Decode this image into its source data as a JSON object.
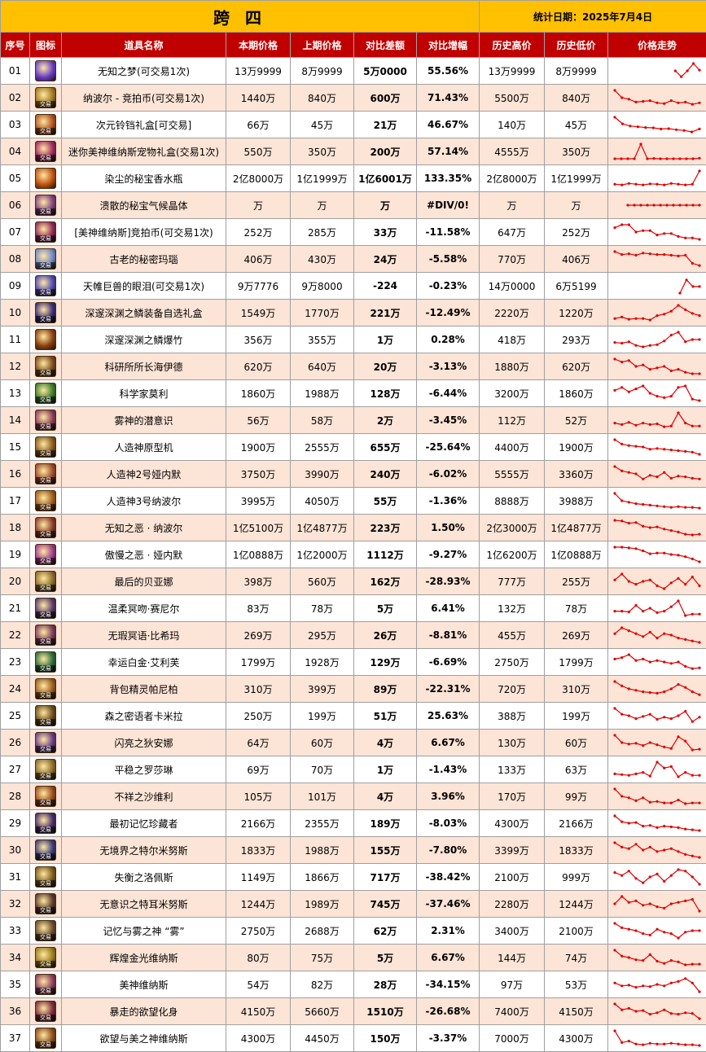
{
  "header": {
    "title": "跨 四",
    "date": "统计日期：2025年7月4日"
  },
  "columns": [
    "序号",
    "图标",
    "道具名称",
    "本期价格",
    "上期价格",
    "对比差额",
    "对比增幅",
    "历史高价",
    "历史低价",
    "价格走势"
  ],
  "icon_tag": "交易",
  "colors": {
    "header_bg": "#c00000",
    "title_bg": "#ffc000",
    "alt_row": "#fce4d6",
    "up": "#e00000",
    "down": "#00a040",
    "spark": "#e00000"
  },
  "rows": [
    {
      "no": "01",
      "name": "无知之梦(可交易1次)",
      "cur": "13万9999",
      "prev": "8万9999",
      "diff": "5万0000",
      "pct": "55.56%",
      "high": "13万9999",
      "low": "8万9999",
      "dir": "up",
      "icon": "purple-orb-icon",
      "icon_color": "#6a3cc8",
      "tag": false,
      "trend": [
        null,
        null,
        null,
        null,
        null,
        null,
        null,
        null,
        null,
        null,
        0.5,
        0.1,
        0.5,
        1.0,
        0.55
      ]
    },
    {
      "no": "02",
      "name": "纳波尔 - 竞拍币(可交易1次)",
      "cur": "1440万",
      "prev": "840万",
      "diff": "600万",
      "pct": "71.43%",
      "high": "5500万",
      "low": "840万",
      "dir": "up",
      "icon": "gold-coin-icon",
      "icon_color": "#a07820",
      "tag": true,
      "trend": [
        1.0,
        0.5,
        0.4,
        0.2,
        0.25,
        0.3,
        0.15,
        0.1,
        0.3,
        0.15,
        0.2,
        0.05,
        0.15
      ]
    },
    {
      "no": "03",
      "name": "次元铃铛礼盒[可交易]",
      "cur": "66万",
      "prev": "45万",
      "diff": "21万",
      "pct": "46.67%",
      "high": "140万",
      "low": "45万",
      "dir": "up",
      "icon": "bell-box-icon",
      "icon_color": "#b05020",
      "tag": true,
      "trend": [
        1.0,
        0.55,
        0.4,
        0.35,
        0.3,
        0.28,
        0.2,
        0.22,
        0.15,
        0.1,
        0.0,
        0.2
      ]
    },
    {
      "no": "04",
      "name": "迷你美神维纳斯宠物礼盒(交易1次)",
      "cur": "550万",
      "prev": "350万",
      "diff": "200万",
      "pct": "57.14%",
      "high": "4555万",
      "low": "350万",
      "dir": "up",
      "icon": "pet-box-icon",
      "icon_color": "#a02860",
      "tag": true,
      "trend": [
        0.0,
        0.0,
        0.0,
        0.0,
        1.0,
        0.0,
        0.02,
        0.0,
        0.0,
        0.0,
        0.0,
        0.0,
        0.0,
        0.04
      ]
    },
    {
      "no": "05",
      "name": "染尘的秘宝香水瓶",
      "cur": "2亿8000万",
      "prev": "1亿1999万",
      "diff": "1亿6001万",
      "pct": "133.35%",
      "high": "2亿8000万",
      "low": "1亿1999万",
      "dir": "up",
      "icon": "perfume-icon",
      "icon_color": "#c05010",
      "tag": false,
      "trend": [
        0.1,
        0.05,
        0.15,
        0.1,
        0.05,
        0.12,
        0.1,
        0.05,
        0.15,
        0.1,
        0.05,
        0.1,
        1.0
      ]
    },
    {
      "no": "06",
      "name": "溃散的秘宝气候晶体",
      "cur": "万",
      "prev": "万",
      "diff": "万",
      "pct": "#DIV/0!",
      "high": "万",
      "low": "万",
      "dir": "up",
      "icon": "crystal-icon",
      "icon_color": "#804080",
      "tag": true,
      "trend": [
        null,
        null,
        0.5,
        0.5,
        0.5,
        0.5,
        0.5,
        0.5,
        0.5,
        0.5,
        0.5,
        0.5,
        0.5,
        0.5
      ]
    },
    {
      "no": "07",
      "name": "[美神维纳斯]竞拍币(可交易1次)",
      "cur": "252万",
      "prev": "285万",
      "diff": "33万",
      "pct": "-11.58%",
      "high": "647万",
      "low": "252万",
      "dir": "down",
      "icon": "auction-coin-icon",
      "icon_color": "#902858",
      "tag": true,
      "trend": [
        0.8,
        1.0,
        1.0,
        0.5,
        0.6,
        0.6,
        0.3,
        0.4,
        0.4,
        0.2,
        0.1,
        0.1,
        0.0
      ]
    },
    {
      "no": "08",
      "name": "古老的秘密玛瑙",
      "cur": "406万",
      "prev": "430万",
      "diff": "24万",
      "pct": "-5.58%",
      "high": "770万",
      "low": "406万",
      "dir": "down",
      "icon": "agate-icon",
      "icon_color": "#7088c8",
      "tag": true,
      "trend": [
        1.0,
        0.8,
        0.85,
        0.75,
        0.9,
        0.85,
        0.8,
        0.8,
        0.75,
        0.7,
        0.75,
        0.2,
        0.05
      ]
    },
    {
      "no": "09",
      "name": "天帷巨兽的眼泪(可交易1次)",
      "cur": "9万7776",
      "prev": "9万8000",
      "diff": "-224",
      "pct": "-0.23%",
      "high": "14万0000",
      "low": "6万5199",
      "dir": "down",
      "icon": "tear-icon",
      "icon_color": "#5048b0",
      "tag": true,
      "trend": [
        null,
        null,
        null,
        null,
        null,
        null,
        null,
        null,
        null,
        null,
        0.0,
        0.9,
        0.45,
        0.45
      ]
    },
    {
      "no": "10",
      "name": "深邃深渊之鳞装备自选礼盒",
      "cur": "1549万",
      "prev": "1770万",
      "diff": "221万",
      "pct": "-12.49%",
      "high": "2220万",
      "low": "1220万",
      "dir": "down",
      "icon": "scale-box-icon",
      "icon_color": "#3a2a78",
      "tag": true,
      "trend": [
        0.1,
        0.2,
        0.05,
        0.1,
        0.1,
        0.0,
        0.3,
        0.4,
        0.6,
        1.0,
        0.7,
        0.45,
        0.3
      ]
    },
    {
      "no": "11",
      "name": "深邃深渊之鳞爆竹",
      "cur": "356万",
      "prev": "355万",
      "diff": "1万",
      "pct": "0.28%",
      "high": "418万",
      "low": "293万",
      "dir": "up",
      "icon": "firecracker-icon",
      "icon_color": "#8a4010",
      "tag": false,
      "trend": [
        0.3,
        0.25,
        0.35,
        0.1,
        0.0,
        0.1,
        0.15,
        0.4,
        0.8,
        1.0,
        0.35,
        0.5,
        0.5
      ]
    },
    {
      "no": "12",
      "name": "科研所所长海伊德",
      "cur": "620万",
      "prev": "640万",
      "diff": "20万",
      "pct": "-3.13%",
      "high": "1880万",
      "low": "620万",
      "dir": "down",
      "icon": "card-icon",
      "icon_color": "#7a4a1a",
      "tag": true,
      "trend": [
        1.0,
        0.8,
        0.9,
        0.5,
        0.6,
        0.3,
        0.4,
        0.5,
        0.2,
        0.3,
        0.1,
        0.0,
        0.0
      ]
    },
    {
      "no": "13",
      "name": "科学家莫利",
      "cur": "1860万",
      "prev": "1988万",
      "diff": "128万",
      "pct": "-6.44%",
      "high": "3200万",
      "low": "1860万",
      "dir": "down",
      "icon": "card-icon",
      "icon_color": "#3a7a2a",
      "tag": true,
      "trend": [
        0.7,
        0.9,
        0.6,
        0.8,
        1.0,
        0.5,
        0.3,
        0.2,
        0.3,
        0.9,
        1.0,
        0.1,
        0.0
      ]
    },
    {
      "no": "14",
      "name": "雾神的潜意识",
      "cur": "56万",
      "prev": "58万",
      "diff": "2万",
      "pct": "-3.45%",
      "high": "112万",
      "low": "52万",
      "dir": "down",
      "icon": "card-icon",
      "icon_color": "#8a3a5a",
      "tag": true,
      "trend": [
        0.3,
        0.2,
        0.35,
        0.15,
        0.3,
        0.2,
        0.25,
        0.05,
        0.1,
        1.0,
        0.3,
        0.1,
        0.1
      ]
    },
    {
      "no": "15",
      "name": "人造神原型机",
      "cur": "1900万",
      "prev": "2555万",
      "diff": "655万",
      "pct": "-25.64%",
      "high": "4400万",
      "low": "1900万",
      "dir": "down",
      "icon": "card-icon",
      "icon_color": "#8a5a1a",
      "tag": true,
      "trend": [
        1.0,
        0.7,
        0.6,
        0.55,
        0.5,
        0.35,
        0.4,
        0.35,
        0.3,
        0.25,
        0.2,
        0.15,
        0.0
      ]
    },
    {
      "no": "16",
      "name": "人造神2号娅内默",
      "cur": "3750万",
      "prev": "3990万",
      "diff": "240万",
      "pct": "-6.02%",
      "high": "5555万",
      "low": "3360万",
      "dir": "down",
      "icon": "card-icon",
      "icon_color": "#9a4a2a",
      "tag": true,
      "trend": [
        1.0,
        0.7,
        0.6,
        0.5,
        0.15,
        0.4,
        0.3,
        0.6,
        0.2,
        0.35,
        0.3,
        0.2,
        0.15
      ]
    },
    {
      "no": "17",
      "name": "人造神3号纳波尔",
      "cur": "3995万",
      "prev": "4050万",
      "diff": "55万",
      "pct": "-1.36%",
      "high": "8888万",
      "low": "3988万",
      "dir": "down",
      "icon": "card-icon",
      "icon_color": "#a05a1a",
      "tag": true,
      "trend": [
        1.0,
        0.5,
        0.4,
        0.3,
        0.25,
        0.2,
        0.15,
        0.1,
        0.05,
        0.1,
        0.05,
        0.05,
        0.0
      ]
    },
    {
      "no": "18",
      "name": "无知之恶 · 纳波尔",
      "cur": "1亿5100万",
      "prev": "1亿4877万",
      "diff": "223万",
      "pct": "1.50%",
      "high": "2亿3000万",
      "low": "1亿4877万",
      "dir": "up",
      "icon": "card-icon",
      "icon_color": "#8a3a2a",
      "tag": true,
      "trend": [
        1.0,
        0.95,
        0.8,
        0.85,
        0.6,
        0.5,
        0.55,
        0.4,
        0.3,
        0.2,
        0.05,
        0.0,
        0.05
      ]
    },
    {
      "no": "19",
      "name": "傲慢之恶 · 娅内默",
      "cur": "1亿0888万",
      "prev": "1亿2000万",
      "diff": "1112万",
      "pct": "-9.27%",
      "high": "1亿6200万",
      "low": "1亿0888万",
      "dir": "down",
      "icon": "card-icon",
      "icon_color": "#a03a8a",
      "tag": true,
      "trend": [
        1.0,
        1.0,
        0.95,
        0.9,
        0.75,
        0.55,
        0.6,
        0.6,
        0.5,
        0.45,
        0.35,
        0.2,
        0.0
      ]
    },
    {
      "no": "20",
      "name": "最后的贝亚娜",
      "cur": "398万",
      "prev": "560万",
      "diff": "162万",
      "pct": "-28.93%",
      "high": "777万",
      "low": "255万",
      "dir": "down",
      "icon": "card-icon",
      "icon_color": "#8a6a2a",
      "tag": true,
      "trend": [
        0.6,
        1.0,
        0.5,
        0.3,
        0.5,
        0.6,
        0.2,
        0.0,
        0.4,
        0.7,
        0.3,
        0.8,
        0.2
      ]
    },
    {
      "no": "21",
      "name": "温柔冥吻·赛尼尔",
      "cur": "83万",
      "prev": "78万",
      "diff": "5万",
      "pct": "6.41%",
      "high": "132万",
      "low": "78万",
      "dir": "up",
      "icon": "card-icon",
      "icon_color": "#5a3a6a",
      "tag": true,
      "trend": [
        0.3,
        0.3,
        0.25,
        0.7,
        0.3,
        0.5,
        0.2,
        0.3,
        0.6,
        1.0,
        0.0,
        0.1,
        0.1
      ]
    },
    {
      "no": "22",
      "name": "无瑕冥语·比希玛",
      "cur": "269万",
      "prev": "295万",
      "diff": "26万",
      "pct": "-8.81%",
      "high": "455万",
      "low": "269万",
      "dir": "down",
      "icon": "card-icon",
      "icon_color": "#7a3a5a",
      "tag": true,
      "trend": [
        0.6,
        1.0,
        0.8,
        0.6,
        0.4,
        0.7,
        0.3,
        0.6,
        0.5,
        0.3,
        0.2,
        0.1,
        0.0
      ]
    },
    {
      "no": "23",
      "name": "幸运白金·艾利芙",
      "cur": "1799万",
      "prev": "1928万",
      "diff": "129万",
      "pct": "-6.69%",
      "high": "2750万",
      "low": "1799万",
      "dir": "down",
      "icon": "card-icon",
      "icon_color": "#2a6a3a",
      "tag": true,
      "trend": [
        0.7,
        0.8,
        1.0,
        0.6,
        0.7,
        0.5,
        0.6,
        0.5,
        0.4,
        0.5,
        0.2,
        0.05,
        0.1
      ]
    },
    {
      "no": "24",
      "name": "背包精灵帕尼柏",
      "cur": "310万",
      "prev": "399万",
      "diff": "89万",
      "pct": "-22.31%",
      "high": "720万",
      "low": "310万",
      "dir": "down",
      "icon": "card-icon",
      "icon_color": "#9a5a1a",
      "tag": true,
      "trend": [
        1.0,
        0.7,
        0.5,
        0.4,
        0.3,
        0.25,
        0.2,
        0.3,
        0.5,
        0.8,
        0.6,
        0.3,
        0.1
      ]
    },
    {
      "no": "25",
      "name": "森之密语者卡米拉",
      "cur": "250万",
      "prev": "199万",
      "diff": "51万",
      "pct": "25.63%",
      "high": "388万",
      "low": "199万",
      "dir": "up",
      "icon": "card-icon",
      "icon_color": "#6a4a1a",
      "tag": true,
      "trend": [
        1.0,
        0.6,
        0.5,
        0.3,
        0.45,
        0.6,
        0.25,
        0.4,
        0.3,
        0.5,
        0.8,
        0.1,
        0.4
      ]
    },
    {
      "no": "26",
      "name": "闪亮之狄安娜",
      "cur": "64万",
      "prev": "60万",
      "diff": "4万",
      "pct": "6.67%",
      "high": "130万",
      "low": "60万",
      "dir": "up",
      "icon": "card-icon",
      "icon_color": "#6a3a8a",
      "tag": true,
      "trend": [
        1.0,
        0.5,
        0.4,
        0.45,
        0.3,
        0.5,
        0.35,
        0.2,
        0.1,
        0.9,
        0.6,
        0.0,
        0.05
      ]
    },
    {
      "no": "27",
      "name": "平稳之罗莎琳",
      "cur": "69万",
      "prev": "70万",
      "diff": "1万",
      "pct": "-1.43%",
      "high": "133万",
      "low": "63万",
      "dir": "down",
      "icon": "card-icon",
      "icon_color": "#8a6a2a",
      "tag": true,
      "trend": [
        0.2,
        0.15,
        0.1,
        0.2,
        0.3,
        0.05,
        1.0,
        0.6,
        0.7,
        0.0,
        0.3,
        0.1,
        0.1
      ]
    },
    {
      "no": "28",
      "name": "不祥之沙维利",
      "cur": "105万",
      "prev": "101万",
      "diff": "4万",
      "pct": "3.96%",
      "high": "170万",
      "low": "99万",
      "dir": "up",
      "icon": "card-icon",
      "icon_color": "#9a4a1a",
      "tag": true,
      "trend": [
        1.0,
        0.5,
        0.4,
        0.2,
        0.4,
        0.1,
        0.15,
        0.05,
        0.05,
        0.25,
        0.0,
        0.05,
        0.05
      ]
    },
    {
      "no": "29",
      "name": "最初记忆珍藏者",
      "cur": "2166万",
      "prev": "2355万",
      "diff": "189万",
      "pct": "-8.03%",
      "high": "4300万",
      "low": "2166万",
      "dir": "down",
      "icon": "card-icon",
      "icon_color": "#4a2a6a",
      "tag": true,
      "trend": [
        1.0,
        0.6,
        0.5,
        0.55,
        0.3,
        0.35,
        0.2,
        0.3,
        0.25,
        0.2,
        0.1,
        0.05,
        0.0
      ]
    },
    {
      "no": "30",
      "name": "无境界之特尔米努斯",
      "cur": "1833万",
      "prev": "1988万",
      "diff": "155万",
      "pct": "-7.80%",
      "high": "3399万",
      "low": "1833万",
      "dir": "down",
      "icon": "card-icon",
      "icon_color": "#3a3a7a",
      "tag": true,
      "trend": [
        1.0,
        0.7,
        0.6,
        0.9,
        0.5,
        0.7,
        0.4,
        0.5,
        0.6,
        0.4,
        0.2,
        0.1,
        0.0
      ]
    },
    {
      "no": "31",
      "name": "失衡之洛佩斯",
      "cur": "1149万",
      "prev": "1866万",
      "diff": "717万",
      "pct": "-38.42%",
      "high": "2100万",
      "low": "999万",
      "dir": "down",
      "icon": "card-icon",
      "icon_color": "#7a5a1a",
      "tag": true,
      "trend": [
        0.8,
        0.6,
        0.9,
        0.4,
        0.1,
        0.5,
        0.7,
        0.2,
        0.6,
        1.0,
        0.9,
        0.5,
        0.0
      ]
    },
    {
      "no": "32",
      "name": "无意识之特耳米努斯",
      "cur": "1244万",
      "prev": "1989万",
      "diff": "745万",
      "pct": "-37.46%",
      "high": "2280万",
      "low": "1244万",
      "dir": "down",
      "icon": "card-icon",
      "icon_color": "#5a3a2a",
      "tag": true,
      "trend": [
        0.5,
        1.0,
        0.6,
        0.7,
        0.4,
        0.5,
        0.3,
        0.2,
        0.5,
        0.6,
        0.7,
        0.8,
        0.0
      ]
    },
    {
      "no": "33",
      "name": "记忆与雾之神 “雾”",
      "cur": "2750万",
      "prev": "2688万",
      "diff": "62万",
      "pct": "2.31%",
      "high": "3400万",
      "low": "2100万",
      "dir": "up",
      "icon": "card-icon",
      "icon_color": "#6a4a2a",
      "tag": true,
      "trend": [
        1.0,
        0.7,
        0.6,
        0.5,
        0.3,
        0.2,
        0.6,
        0.4,
        0.3,
        0.0,
        0.4,
        0.5,
        0.5
      ]
    },
    {
      "no": "34",
      "name": "辉煌金光维纳斯",
      "cur": "80万",
      "prev": "75万",
      "diff": "5万",
      "pct": "6.67%",
      "high": "144万",
      "low": "74万",
      "dir": "up",
      "icon": "card-icon",
      "icon_color": "#9a7a1a",
      "tag": true,
      "trend": [
        1.0,
        0.6,
        0.5,
        0.35,
        0.3,
        0.7,
        0.25,
        0.1,
        0.3,
        0.2,
        0.0,
        0.05,
        0.05
      ]
    },
    {
      "no": "35",
      "name": "美神维纳斯",
      "cur": "54万",
      "prev": "82万",
      "diff": "28万",
      "pct": "-34.15%",
      "high": "97万",
      "low": "53万",
      "dir": "down",
      "icon": "card-icon",
      "icon_color": "#8a3a5a",
      "tag": true,
      "trend": [
        0.6,
        0.4,
        0.45,
        0.3,
        0.4,
        0.35,
        0.5,
        0.4,
        0.6,
        0.7,
        0.9,
        0.6,
        0.0
      ]
    },
    {
      "no": "36",
      "name": "暴走的欲望化身",
      "cur": "4150万",
      "prev": "5660万",
      "diff": "1510万",
      "pct": "-26.68%",
      "high": "7400万",
      "low": "4150万",
      "dir": "down",
      "icon": "card-icon",
      "icon_color": "#7a2a3a",
      "tag": true,
      "trend": [
        1.0,
        0.6,
        0.7,
        0.5,
        0.55,
        0.3,
        0.4,
        0.6,
        0.35,
        0.3,
        0.4,
        0.35,
        0.0
      ]
    },
    {
      "no": "37",
      "name": "欲望与美之神维纳斯",
      "cur": "4300万",
      "prev": "4450万",
      "diff": "150万",
      "pct": "-3.37%",
      "high": "7000万",
      "low": "4300万",
      "dir": "down",
      "icon": "card-icon",
      "icon_color": "#8a4a1a",
      "tag": true,
      "trend": [
        1.0,
        0.2,
        0.3,
        0.1,
        0.05,
        0.15,
        0.1,
        0.1,
        0.15,
        0.1,
        0.05,
        0.05,
        0.0
      ]
    }
  ]
}
